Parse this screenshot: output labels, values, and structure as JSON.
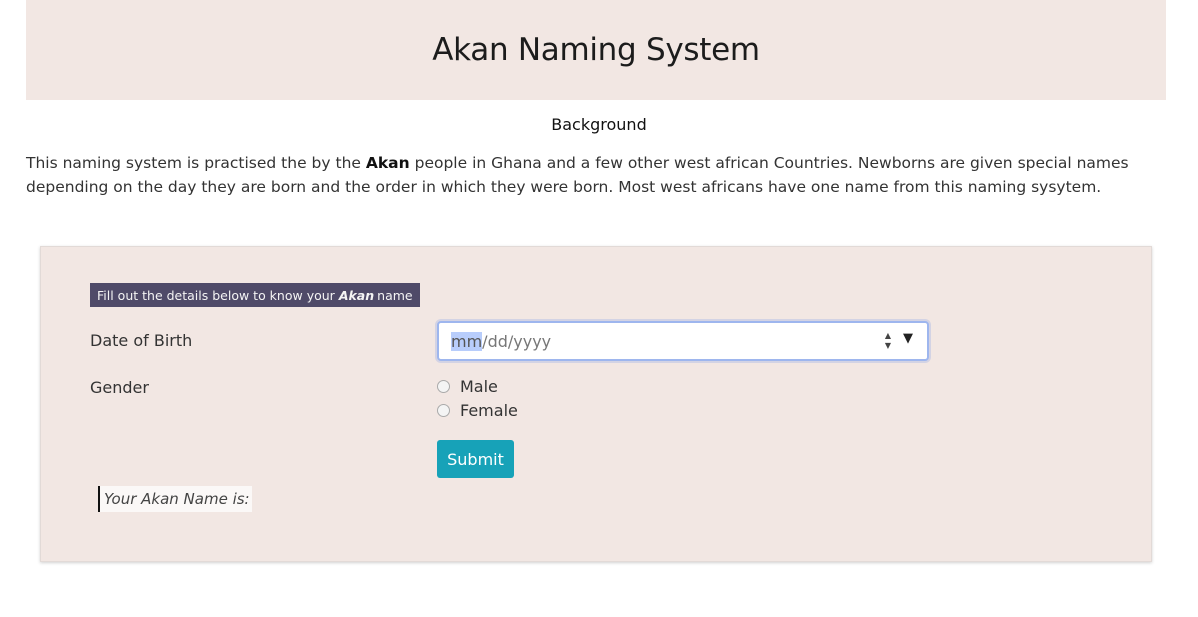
{
  "header": {
    "title": "Akan Naming System"
  },
  "background": {
    "heading": "Background",
    "text_before": "This naming system is practised the by the ",
    "highlight": "Akan",
    "text_after": " people in Ghana and a few other west african Countries. Newborns are given special names depending on the day they are born and the order in which they were born. Most west africans have one name from this naming sysytem."
  },
  "form": {
    "prompt_before": "Fill out the details below to know your",
    "prompt_emphasis": "Akan",
    "prompt_after": "name",
    "dob_label": "Date of Birth",
    "dob_placeholder_mm": "mm",
    "dob_placeholder_rest": "/dd/yyyy",
    "gender_label": "Gender",
    "gender_options": [
      "Male",
      "Female"
    ],
    "submit_label": "Submit",
    "result_label": "Your Akan Name is:"
  },
  "icons": {
    "spin_up": "▲",
    "spin_down": "▼",
    "dropdown": "▼"
  },
  "colors": {
    "panel_bg": "#f2e7e3",
    "prompt_bg": "#4f4a68",
    "submit_bg": "#17a2b8"
  }
}
